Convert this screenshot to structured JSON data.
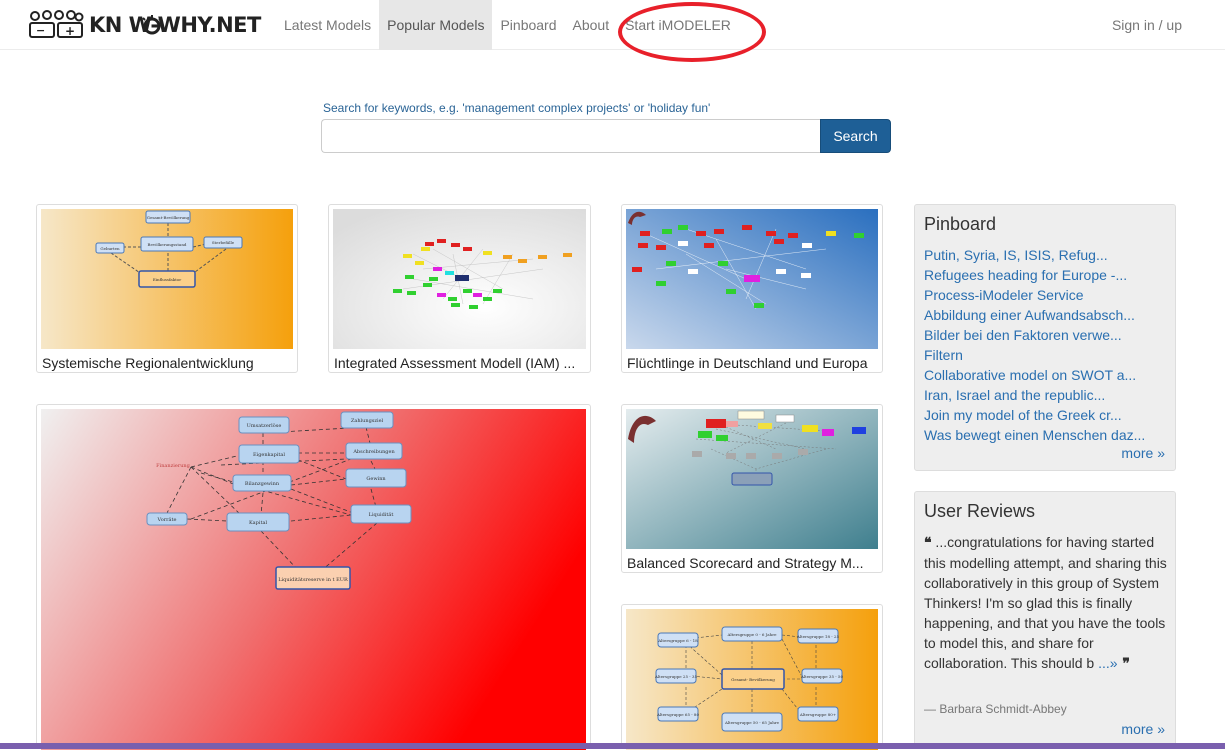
{
  "header": {
    "brand": "KN   W-WHY.NET",
    "nav": [
      "Latest Models",
      "Popular Models",
      "Pinboard",
      "About",
      "Start iMODELER"
    ],
    "active_index": 1,
    "signin": "Sign in / up"
  },
  "search": {
    "hint": "Search for keywords, e.g. 'management complex projects' or 'holiday fun'",
    "value": "",
    "button": "Search"
  },
  "models": [
    {
      "title": "Systemische Regionalentwicklung"
    },
    {
      "title": "Integrated Assessment Modell (IAM) ..."
    },
    {
      "title": "Flüchtlinge in Deutschland und Europa"
    },
    {
      "title": ""
    },
    {
      "title": "Balanced Scorecard and Strategy M..."
    },
    {
      "title": ""
    }
  ],
  "diagram1": {
    "nodes": [
      "Gesamt-Bevölkerung",
      "Bevölkerungsstand",
      "Geburten",
      "Sterbefälle",
      "Einflussfaktor"
    ]
  },
  "diagram4": {
    "nodes": [
      "Umsatzerlöse",
      "Zahlungsziel",
      "Gewinn",
      "Abschreibungen",
      "Finanzierung",
      "Liquidität",
      "Kapital",
      "Vorräte",
      "Bilanzgewinn",
      "Eigenkapital",
      "Liquiditätsreserve in t EUR"
    ]
  },
  "diagram6": {
    "nodes": [
      "Altersgruppe 0 - 6 Jahre",
      "Gesamt- Bevölkerung",
      "Altersgruppe 50 - 65 Jahre",
      "Altersgruppe 6 - 18",
      "Altersgruppe 18 - 25",
      "Altersgruppe 25 - 35",
      "Altersgruppe 35 - 50",
      "Altersgruppe 65 - 80",
      "Altersgruppe 80+"
    ]
  },
  "pinboard": {
    "title": "Pinboard",
    "items": [
      "Putin, Syria, IS, ISIS, Refug...",
      "Refugees heading for Europe -...",
      "Process-iModeler Service",
      "Abbildung einer Aufwandsabsch...",
      "Bilder bei den Faktoren verwe...",
      "Filtern",
      "Collaborative model on SWOT a...",
      "Iran, Israel and the republic...",
      "Join my model of the Greek cr...",
      "Was bewegt einen Menschen daz..."
    ],
    "more": "more »"
  },
  "reviews": {
    "title": "User Reviews",
    "open_quote": "❝",
    "text": " ...congratulations for having started this modelling attempt, and sharing this collaboratively in this group of System Thinkers! I'm so glad this is finally happening, and that you have the tools to model this, and share for collaboration. This should b ",
    "inline_more": "...»",
    "close_quote": " ❞",
    "author": "— Barbara Schmidt-Abbey",
    "more": "more »"
  },
  "colors": {
    "primary": "#1e5f96",
    "link": "#2a6fb0",
    "highlight": "#e8202a"
  }
}
